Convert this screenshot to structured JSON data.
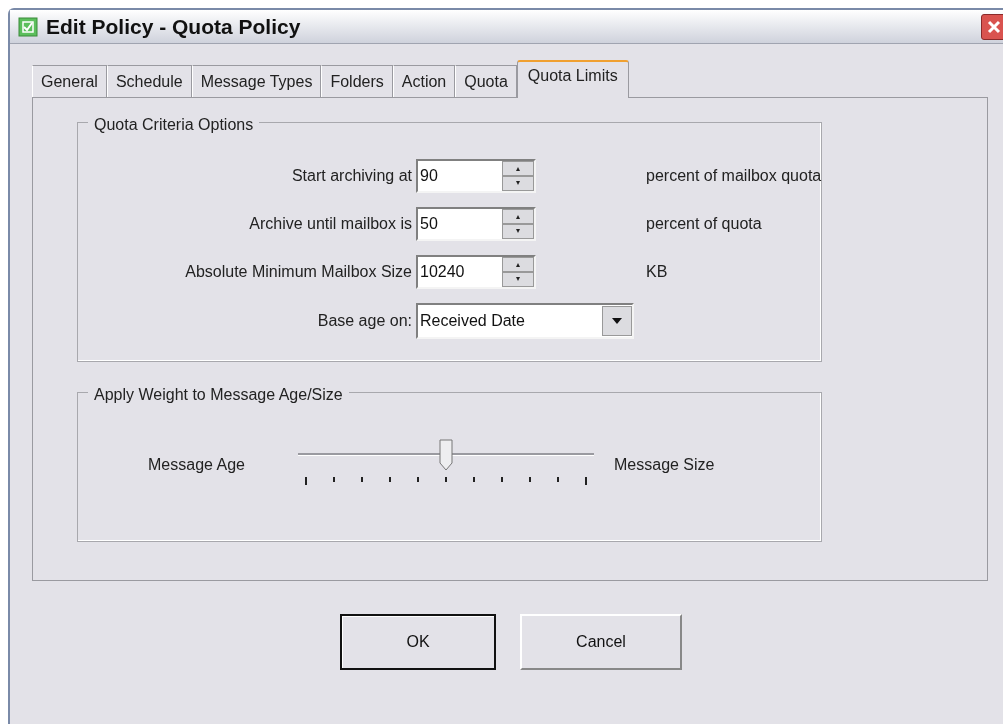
{
  "window": {
    "title": "Edit Policy - Quota Policy"
  },
  "tabs": [
    {
      "label": "General",
      "selected": false
    },
    {
      "label": "Schedule",
      "selected": false
    },
    {
      "label": "Message Types",
      "selected": false
    },
    {
      "label": "Folders",
      "selected": false
    },
    {
      "label": "Action",
      "selected": false
    },
    {
      "label": "Quota",
      "selected": false
    },
    {
      "label": "Quota Limits",
      "selected": true
    }
  ],
  "quota_criteria": {
    "title": "Quota Criteria Options",
    "fields": [
      {
        "kind": "spin",
        "label": "Start archiving at",
        "value": "90",
        "suffix": "percent of mailbox quota"
      },
      {
        "kind": "spin",
        "label": "Archive until mailbox is",
        "value": "50",
        "suffix": "percent of quota"
      },
      {
        "kind": "spin",
        "label": "Absolute Minimum Mailbox Size",
        "value": "10240",
        "suffix": "KB"
      },
      {
        "kind": "dropdown",
        "label": "Base age on:",
        "value": "Received Date"
      }
    ]
  },
  "weight": {
    "title": "Apply Weight to Message Age/Size",
    "left_label": "Message Age",
    "right_label": "Message Size",
    "level": 0.5
  },
  "buttons": [
    "OK",
    "Cancel"
  ]
}
